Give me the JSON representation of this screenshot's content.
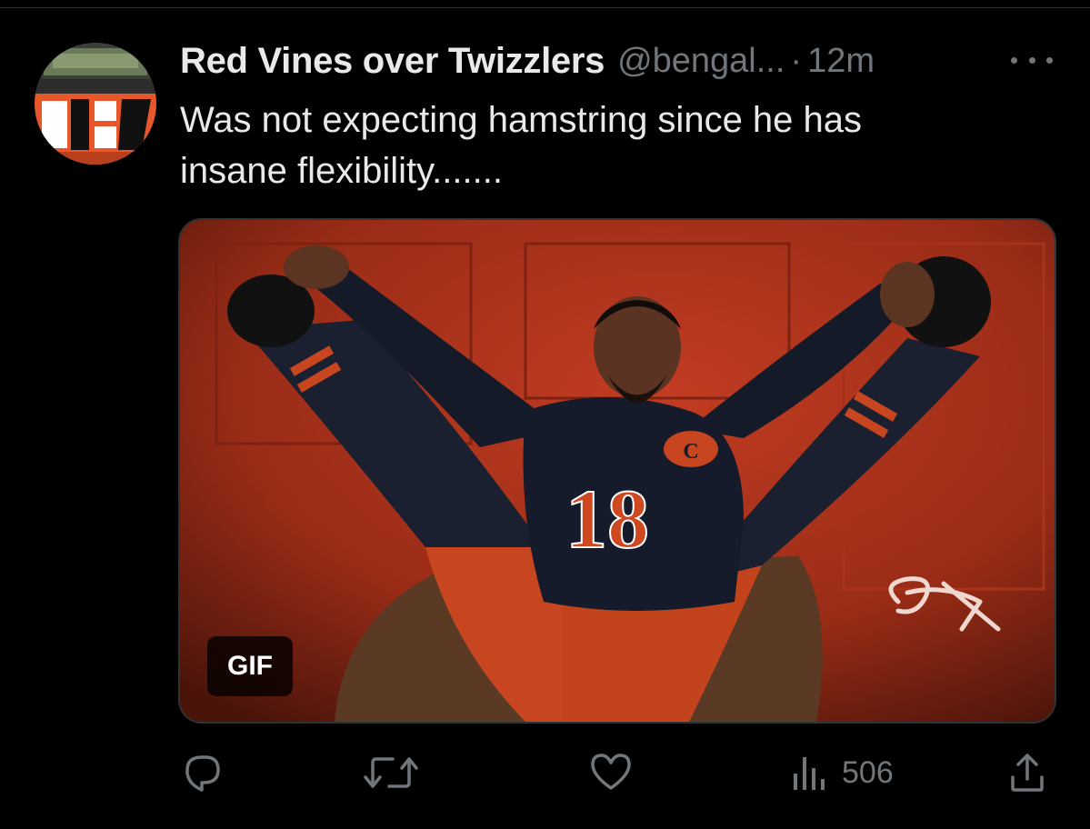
{
  "tweet": {
    "display_name": "Red Vines over Twizzlers",
    "handle": "@bengal...",
    "separator": "·",
    "time": "12m",
    "text_line1": "Was not expecting hamstring since he has",
    "text_line2": "insane flexibility.......",
    "media": {
      "badge": "GIF",
      "jersey_number": "18"
    }
  },
  "actions": {
    "reply": {
      "icon": "reply-icon"
    },
    "retweet": {
      "icon": "retweet-icon"
    },
    "like": {
      "icon": "heart-icon"
    },
    "views": {
      "icon": "views-icon",
      "count": "506"
    },
    "share": {
      "icon": "share-icon"
    }
  },
  "colors": {
    "background": "#000000",
    "text_primary": "#e7e9ea",
    "text_secondary": "#71767b",
    "bengals_orange": "#e8572a",
    "backdrop_red": "#b03520"
  }
}
